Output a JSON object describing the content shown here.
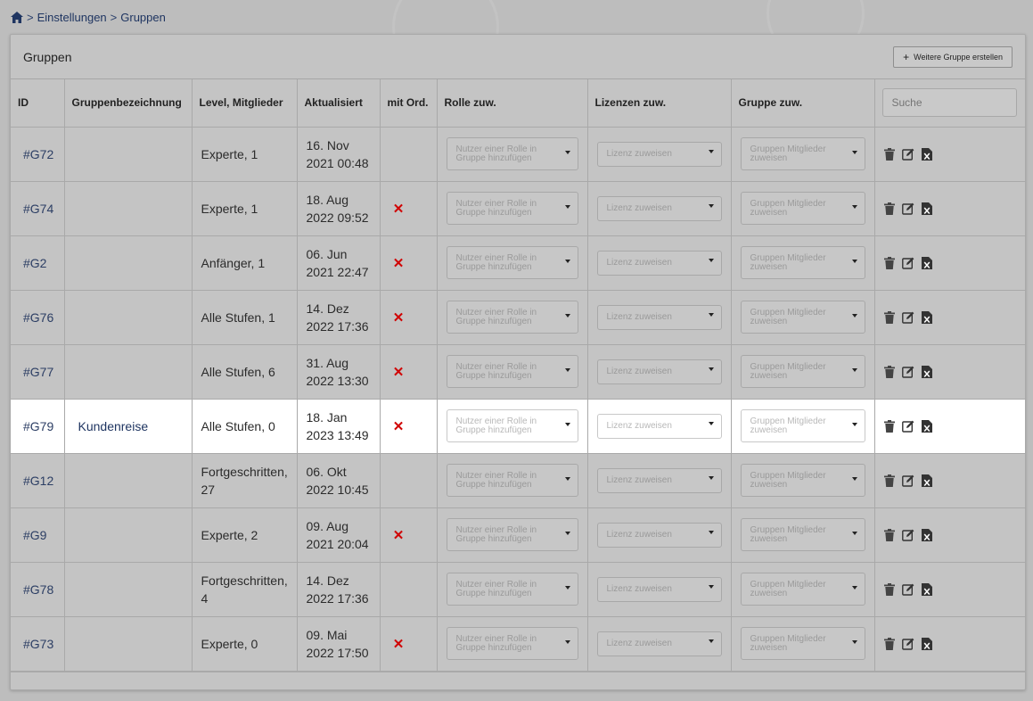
{
  "breadcrumb": {
    "sep1": ">",
    "item1": "Einstellungen",
    "sep2": ">",
    "item2": "Gruppen"
  },
  "panel": {
    "title": "Gruppen",
    "add_button": "Weitere Gruppe erstellen"
  },
  "columns": {
    "id": "ID",
    "name": "Gruppenbezeichnung",
    "level": "Level, Mitglieder",
    "updated": "Aktualisiert",
    "ord": "mit Ord.",
    "role": "Rolle zuw.",
    "license": "Lizenzen zuw.",
    "group": "Gruppe zuw."
  },
  "search": {
    "placeholder": "Suche"
  },
  "placeholders": {
    "role": "Nutzer einer Rolle in Gruppe hinzufügen",
    "license": "Lizenz zuweisen",
    "group": "Gruppen Mitglieder zuweisen"
  },
  "rows": [
    {
      "id": "#G72",
      "name": "",
      "level": "Experte, 1",
      "date": "16. Nov",
      "time": "2021 00:48",
      "ord": ""
    },
    {
      "id": "#G74",
      "name": "",
      "level": "Experte, 1",
      "date": "18. Aug",
      "time": "2022 09:52",
      "ord": "✕"
    },
    {
      "id": "#G2",
      "name": "",
      "level": "Anfänger, 1",
      "date": "06. Jun",
      "time": "2021 22:47",
      "ord": "✕"
    },
    {
      "id": "#G76",
      "name": "",
      "level": "Alle Stufen, 1",
      "date": "14. Dez",
      "time": "2022 17:36",
      "ord": "✕"
    },
    {
      "id": "#G77",
      "name": "",
      "level": "Alle Stufen, 6",
      "date": "31. Aug",
      "time": "2022 13:30",
      "ord": "✕"
    },
    {
      "id": "#G79",
      "name": "Kundenreise",
      "level": "Alle Stufen, 0",
      "date": "18. Jan",
      "time": "2023 13:49",
      "ord": "✕"
    },
    {
      "id": "#G12",
      "name": "",
      "level": "Fortgeschritten, 27",
      "date": "06. Okt",
      "time": "2022 10:45",
      "ord": ""
    },
    {
      "id": "#G9",
      "name": "",
      "level": "Experte, 2",
      "date": "09. Aug",
      "time": "2021 20:04",
      "ord": "✕"
    },
    {
      "id": "#G78",
      "name": "",
      "level": "Fortgeschritten, 4",
      "date": "14. Dez",
      "time": "2022 17:36",
      "ord": ""
    },
    {
      "id": "#G73",
      "name": "",
      "level": "Experte, 0",
      "date": "09. Mai",
      "time": "2022 17:50",
      "ord": "✕"
    }
  ],
  "highlighted_row": "#G79",
  "colors": {
    "accent": "#1f3561",
    "danger": "#d00000",
    "overlay": "#bdbdbd"
  },
  "icons": [
    "home-icon",
    "plus-icon",
    "trash-icon",
    "edit-icon",
    "excel-export-icon",
    "chevron-down-icon"
  ]
}
